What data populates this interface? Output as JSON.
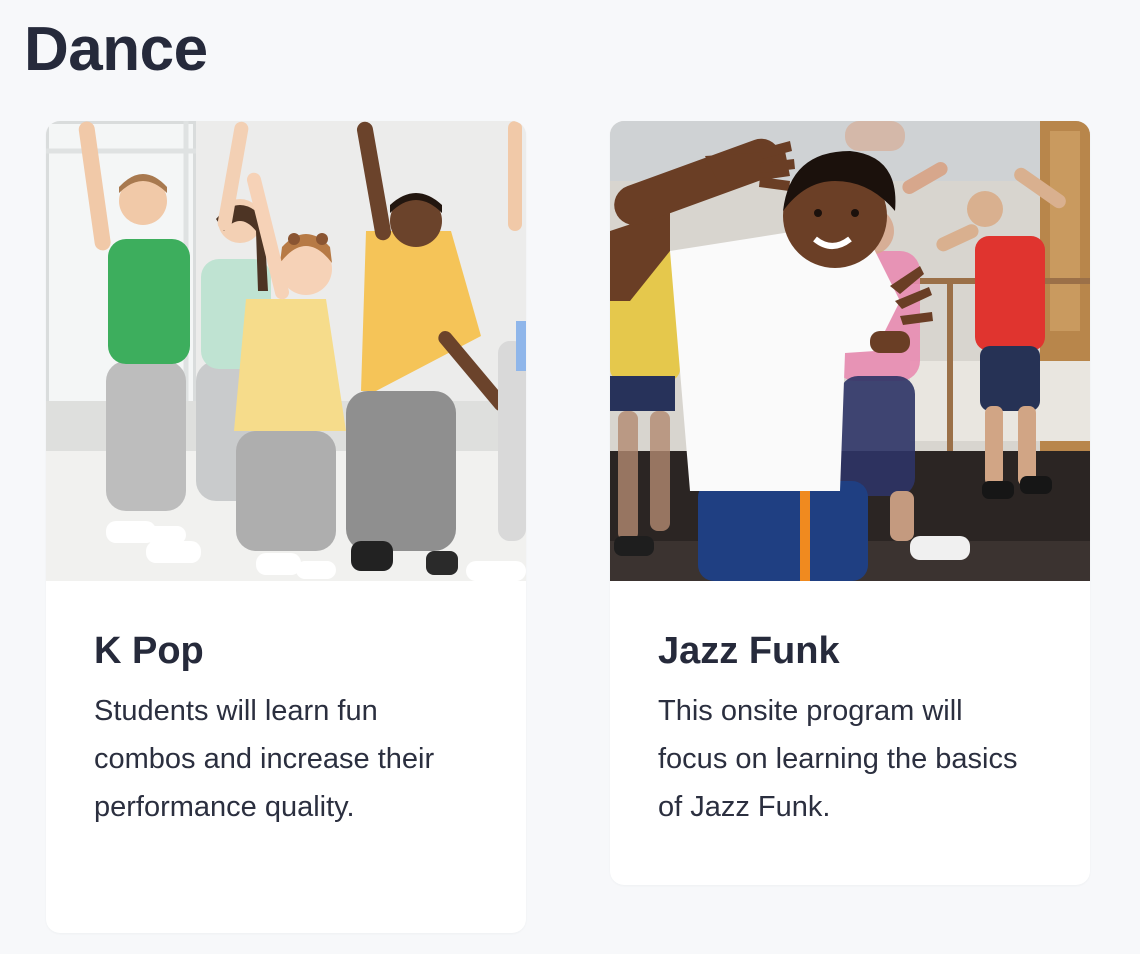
{
  "section": {
    "title": "Dance"
  },
  "cards": [
    {
      "title": "K Pop",
      "description": "Students will learn fun combos and increase their performance quality.",
      "image_icon": "kids-dancing-photo"
    },
    {
      "title": "Jazz Funk",
      "description": "This onsite program will focus on learning the basics of Jazz Funk.",
      "image_icon": "boy-dancing-photo"
    }
  ],
  "colors": {
    "background": "#f7f8fa",
    "card": "#ffffff",
    "text": "#262a3b"
  }
}
